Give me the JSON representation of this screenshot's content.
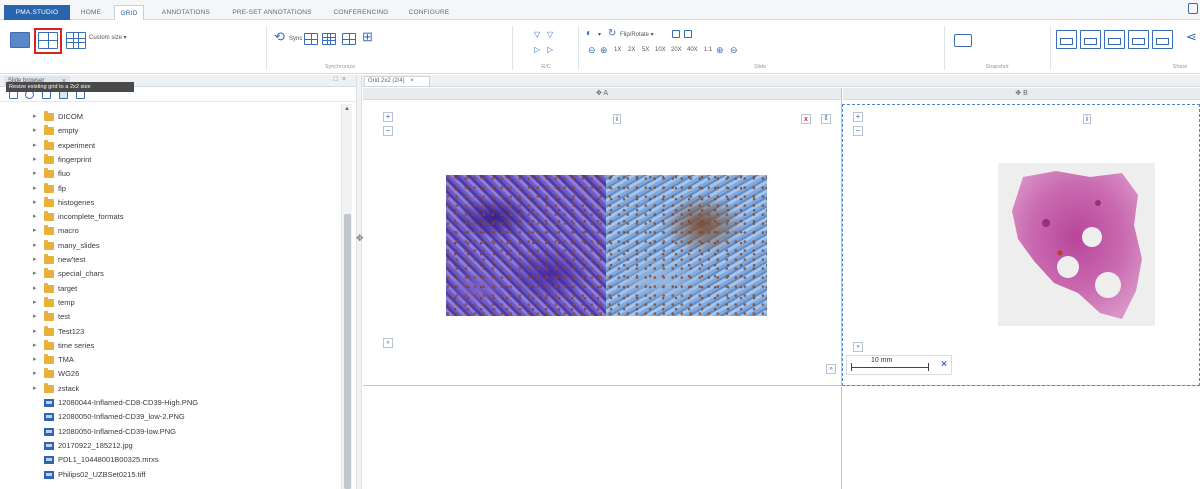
{
  "menubar": {
    "app_tab": "PMA.STUDIO",
    "tabs": [
      "HOME",
      "GRID",
      "ANNOTATIONS",
      "PRE-SET ANNOTATIONS",
      "CONFERENCING",
      "CONFIGURE"
    ],
    "active_tab": "GRID"
  },
  "ribbon": {
    "custom_size_label": "Custom size",
    "sync_label": "Sync",
    "flip_rotate_label": "Flip/Rotate",
    "zoom_levels": [
      "1X",
      "2X",
      "5X",
      "10X",
      "20X",
      "40X",
      "1:1"
    ],
    "tooltip": "Resize existing grid to a 2x2 size",
    "groups": {
      "synchronize": "Synchronize",
      "rc": "R/C",
      "slide": "Slide",
      "snapshot": "Snapshot",
      "share": "Share"
    }
  },
  "slide_browser": {
    "tab_label": "Slide browser",
    "folders": [
      "DICOM",
      "empty",
      "experiment",
      "fingerprint",
      "fluo",
      "flp",
      "histogenes",
      "incomplete_formats",
      "macro",
      "many_slides",
      "new'test",
      "special_chars",
      "target",
      "temp",
      "test",
      "Test123",
      "time series",
      "TMA",
      "WG26",
      "zstack"
    ],
    "files": [
      "12080044-Inflamed-CD8-CD39-High.PNG",
      "12080050-Inflamed-CD39_low-2.PNG",
      "12080050-Inflamed-CD39-low.PNG",
      "20170922_185212.jpg",
      "PDL1_10448001B00325.mrxs",
      "Philips02_UZBSet0215.tiff"
    ]
  },
  "viewer": {
    "tab_label": "Grid 2x2 (2/4)",
    "panel_a_label": "A",
    "panel_b_label": "B",
    "scalebar_label": "10 mm"
  },
  "colors": {
    "accent": "#2a64ad",
    "icon": "#3a6db5",
    "selection": "#e02020",
    "folder": "#e8b23a",
    "dashed_selection": "#4a86d0"
  }
}
